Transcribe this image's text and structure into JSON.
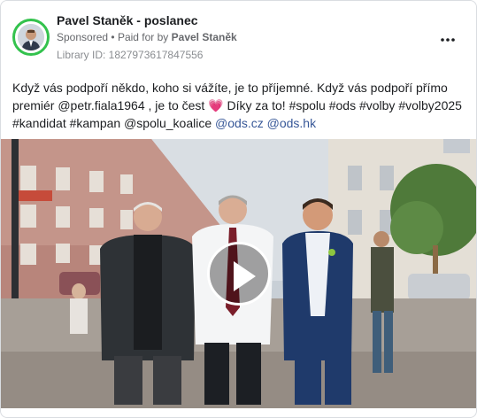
{
  "post": {
    "page_name": "Pavel Staněk - poslanec",
    "sponsored": "Sponsored",
    "paid_for_prefix": "Paid for by",
    "paid_for_by": "Pavel Staněk",
    "library_id": "Library ID: 1827973617847556",
    "more_icon": "more-horizontal-icon"
  },
  "text": {
    "line1": "Když vás podpoří někdo, koho si vážíte, je to příjemné. Když vás podpoří přímo",
    "line2_a": "premiér @petr.fiala1964 , je to čest ",
    "heart": "💗",
    "line2_b": " Díky za to! #spolu #ods #volby #volby2025",
    "line3_a": "#kandidat #kampan @spolu_koalice ",
    "link1": "@ods.cz",
    "link2": "@ods.hk"
  },
  "video": {
    "play_icon": "play-icon"
  },
  "colors": {
    "accent_link": "#385898",
    "avatar_ring": "#33c24d",
    "secondary_text": "#65676b"
  }
}
